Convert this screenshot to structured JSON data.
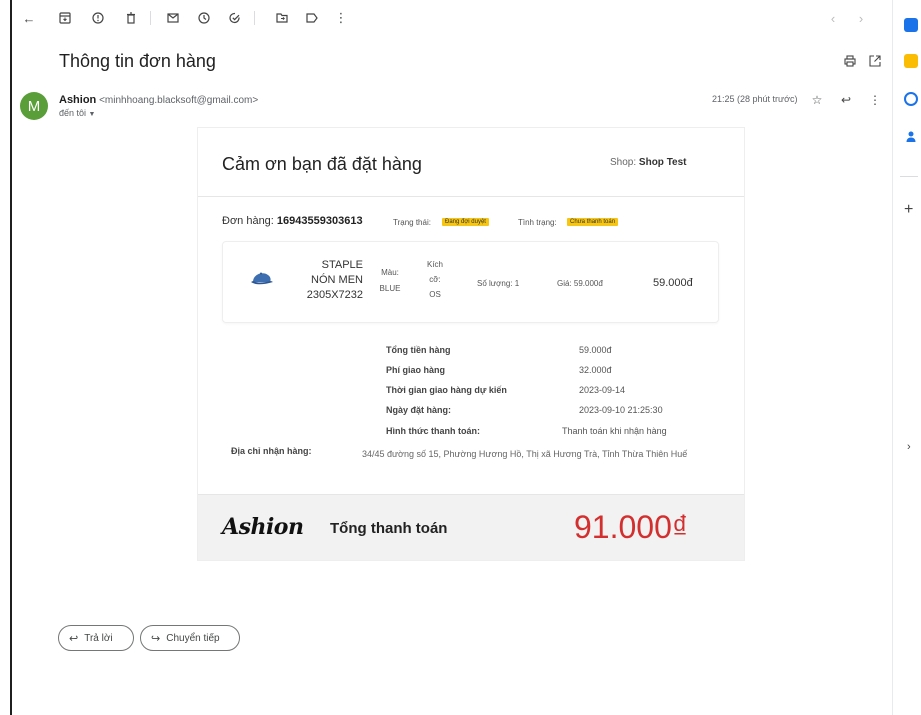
{
  "toolbar": {
    "icons": [
      "back-arrow-icon",
      "archive-icon",
      "report-icon",
      "delete-icon",
      "mark-unread-icon",
      "snooze-icon",
      "add-task-icon",
      "move-icon",
      "label-icon",
      "more-vert-icon",
      "prev-icon",
      "next-icon"
    ]
  },
  "message": {
    "subject": "Thông tin đơn hàng",
    "avatar_letter": "M",
    "sender_name": "Ashion",
    "sender_email": "<minhhoang.blacksoft@gmail.com>",
    "to_label": "đến tôi",
    "time": "21:25 (28 phút trước)"
  },
  "email": {
    "thanks": "Cảm ơn bạn đã đặt hàng",
    "shop_label": "Shop:",
    "shop_name": "Shop Test",
    "order_label": "Đơn hàng:",
    "order_id": "16943559303613",
    "status_label": "Trạng thái:",
    "status_value": "Đang đợi duyệt",
    "payment_state_label": "Tình trạng:",
    "payment_state_value": "Chưa thanh toán",
    "item": {
      "name_line1": "STAPLE",
      "name_line2": "NÓN MEN",
      "name_line3": "2305X7232",
      "color_label": "Màu:",
      "color_value": "BLUE",
      "size_label1": "Kích",
      "size_label2": "cỡ:",
      "size_value": "OS",
      "qty": "Số lượng: 1",
      "unit_price": "Giá: 59.000đ",
      "line_total": "59.000đ"
    },
    "summary": [
      {
        "label": "Tổng tiền hàng",
        "value": "59.000đ"
      },
      {
        "label": "Phí giao hàng",
        "value": "32.000đ"
      },
      {
        "label": "Thời gian giao hàng dự kiến",
        "value": "2023-09-14"
      },
      {
        "label": "Ngày đặt hàng:",
        "value": "2023-09-10 21:25:30"
      },
      {
        "label": "Hình thức thanh toán:",
        "value": "Thanh toán khi nhận hàng"
      }
    ],
    "address_label": "Địa chỉ nhận hàng:",
    "address_value": "34/45 đường số 15, Phường Hương Hồ, Thị xã Hương Trà, Tỉnh Thừa Thiên Huế",
    "brand": "Ashion",
    "total_label": "Tổng thanh toán",
    "total_value": "91.000₫"
  },
  "actions": {
    "reply": "Trả lời",
    "forward": "Chuyển tiếp"
  },
  "colors": {
    "badge": "#f7c613",
    "total": "#d32f2f",
    "avatar": "#5a9e3a"
  }
}
